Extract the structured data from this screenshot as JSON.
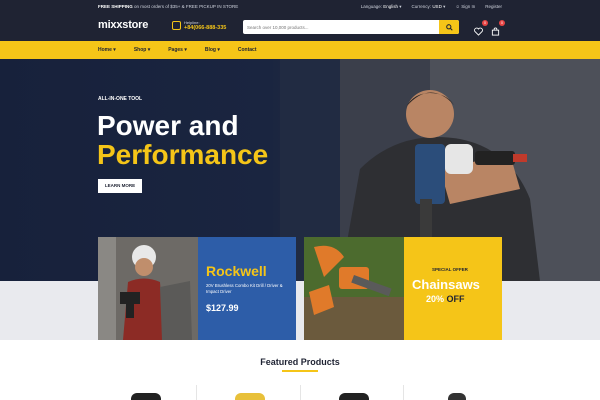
{
  "topbar": {
    "promo_strong": "FREE SHIPPING",
    "promo_rest": " on most orders of $35+ & FREE PICKUP IN STORE",
    "language_label": "Language:",
    "language_value": "English",
    "currency_label": "Currency:",
    "currency_value": "USD",
    "sign_in": "Sign In",
    "register": "Register"
  },
  "header": {
    "logo": "mixxstore",
    "helpline_label": "Helpline:",
    "helpline_number": "+84(066-888-335",
    "search_placeholder": "Search over 10,000 products...",
    "wishlist_count": "0",
    "cart_count": "0"
  },
  "nav": {
    "items": [
      {
        "label": "Home"
      },
      {
        "label": "Shop"
      },
      {
        "label": "Pages"
      },
      {
        "label": "Blog"
      },
      {
        "label": "Contact"
      }
    ]
  },
  "hero": {
    "kicker": "ALL-IN-ONE TOOL",
    "line1": "Power and",
    "line2": "Performance",
    "cta": "LEARN MORE"
  },
  "banners": [
    {
      "title": "Rockwell",
      "subtitle": "20V Brushless Combo Kit Drill / Driver & Impact Driver",
      "price": "$127.99"
    },
    {
      "kicker": "SPECIAL OFFER",
      "title": "Chainsaws",
      "discount_value": "20%",
      "discount_word": " OFF"
    }
  ],
  "featured": {
    "title": "Featured Products"
  },
  "colors": {
    "dark": "#1f2333",
    "accent": "#f5c518",
    "blue": "#2d5da8"
  }
}
